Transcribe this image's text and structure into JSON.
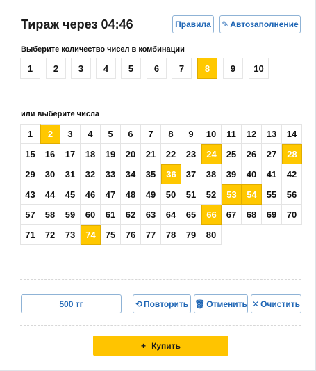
{
  "header": {
    "title": "Тираж через 04:46",
    "rules_label": "Правила",
    "autofill_label": "Автозаполнение"
  },
  "count_section": {
    "label": "Выберите количество чисел в комбинации",
    "options": [
      "1",
      "2",
      "3",
      "4",
      "5",
      "6",
      "7",
      "8",
      "9",
      "10"
    ],
    "selected": "8"
  },
  "numbers_section": {
    "label": "или выберите числа",
    "numbers": [
      "1",
      "2",
      "3",
      "4",
      "5",
      "6",
      "7",
      "8",
      "9",
      "10",
      "11",
      "12",
      "13",
      "14",
      "15",
      "16",
      "17",
      "18",
      "19",
      "20",
      "21",
      "22",
      "23",
      "24",
      "25",
      "26",
      "27",
      "28",
      "29",
      "30",
      "31",
      "32",
      "33",
      "34",
      "35",
      "36",
      "37",
      "38",
      "39",
      "40",
      "41",
      "42",
      "43",
      "44",
      "45",
      "46",
      "47",
      "48",
      "49",
      "50",
      "51",
      "52",
      "53",
      "54",
      "55",
      "56",
      "57",
      "58",
      "59",
      "60",
      "61",
      "62",
      "63",
      "64",
      "65",
      "66",
      "67",
      "68",
      "69",
      "70",
      "71",
      "72",
      "73",
      "74",
      "75",
      "76",
      "77",
      "78",
      "79",
      "80"
    ],
    "selected": [
      "2",
      "24",
      "28",
      "36",
      "53",
      "54",
      "66",
      "74"
    ]
  },
  "actions": {
    "price": "500 тг",
    "repeat_label": "Повторить",
    "cancel_label": "Отменить",
    "clear_label": "Очистить"
  },
  "buy": {
    "label": "Купить"
  },
  "icons": {
    "autofill": "pencil-icon",
    "repeat": "repeat-icon",
    "cancel": "trash-icon",
    "clear": "close-icon",
    "buy": "plus-icon"
  },
  "colors": {
    "accent": "#ffc800",
    "link": "#1f66b5",
    "border": "#8fb3d6"
  }
}
